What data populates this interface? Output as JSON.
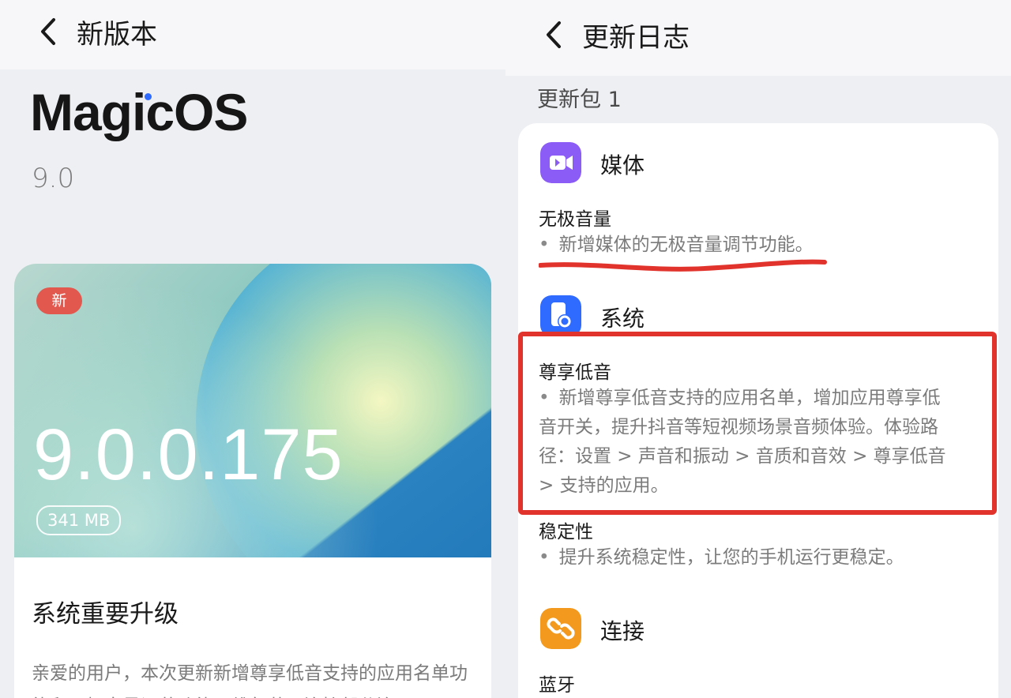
{
  "left": {
    "header": {
      "title": "新版本",
      "back_icon": "chevron-left-icon"
    },
    "brand": "MagicOS",
    "os_version": "9.0",
    "card": {
      "badge": "新",
      "build": "9.0.0.175",
      "size": "341 MB",
      "section_title": "系统重要升级",
      "description": "亲爱的用户，本次更新新增尊享低音支持的应用名单功能和无极音量调节功能，维每蓝牙连接部分连"
    }
  },
  "right": {
    "header": {
      "title": "更新日志",
      "back_icon": "chevron-left-icon"
    },
    "package": "更新包 1",
    "sections": [
      {
        "category": "媒体",
        "icon": "video-camera-icon",
        "icon_color": "#8b5cf6",
        "items": [
          {
            "title": "无极音量",
            "desc": "新增媒体的无极音量调节功能。"
          }
        ]
      },
      {
        "category": "系统",
        "icon": "phone-settings-icon",
        "icon_color": "#2f6bff",
        "items": [
          {
            "title": "尊享低音",
            "desc_lines": [
              "新增尊享低音支持的应用名单，增加应用尊享低",
              "音开关，提升抖音等短视频场景音频体验。体验路",
              "径：设置 > 声音和振动 > 音质和音效 > 尊享低音",
              "> 支持的应用。"
            ]
          },
          {
            "title": "稳定性",
            "desc": "提升系统稳定性，让您的手机运行更稳定。"
          }
        ]
      },
      {
        "category": "连接",
        "icon": "link-icon",
        "icon_color": "#f39a1e",
        "items": [
          {
            "title": "蓝牙"
          }
        ]
      }
    ],
    "bullet": "•"
  },
  "colors": {
    "annotation_red": "#e1332b",
    "badge_red": "#e3584e"
  }
}
